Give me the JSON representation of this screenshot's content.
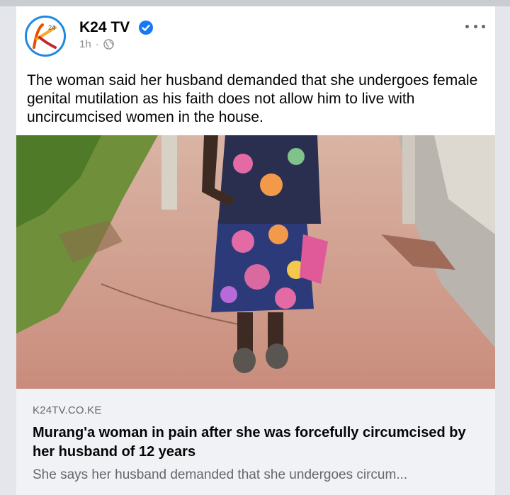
{
  "post": {
    "author": "K24 TV",
    "avatar_text": "k",
    "avatar_badge": "24",
    "time": "1h",
    "separator": "·",
    "audience_icon": "globe-icon",
    "verified_icon": "verified-badge-icon",
    "more_icon": "more-options-icon",
    "text": "The woman said her husband demanded that she undergoes female genital mutilation as his faith does not allow him to live with uncircumcised women in the house."
  },
  "link_preview": {
    "domain": "K24TV.CO.KE",
    "title": "Murang'a woman in pain after she was forcefully circumcised by her husband of 12 years",
    "description": "She says her husband demanded that she undergoes circum..."
  },
  "colors": {
    "verified": "#1877f2",
    "avatar_ring": "#1e88e5",
    "avatar_k": "#e65100"
  }
}
